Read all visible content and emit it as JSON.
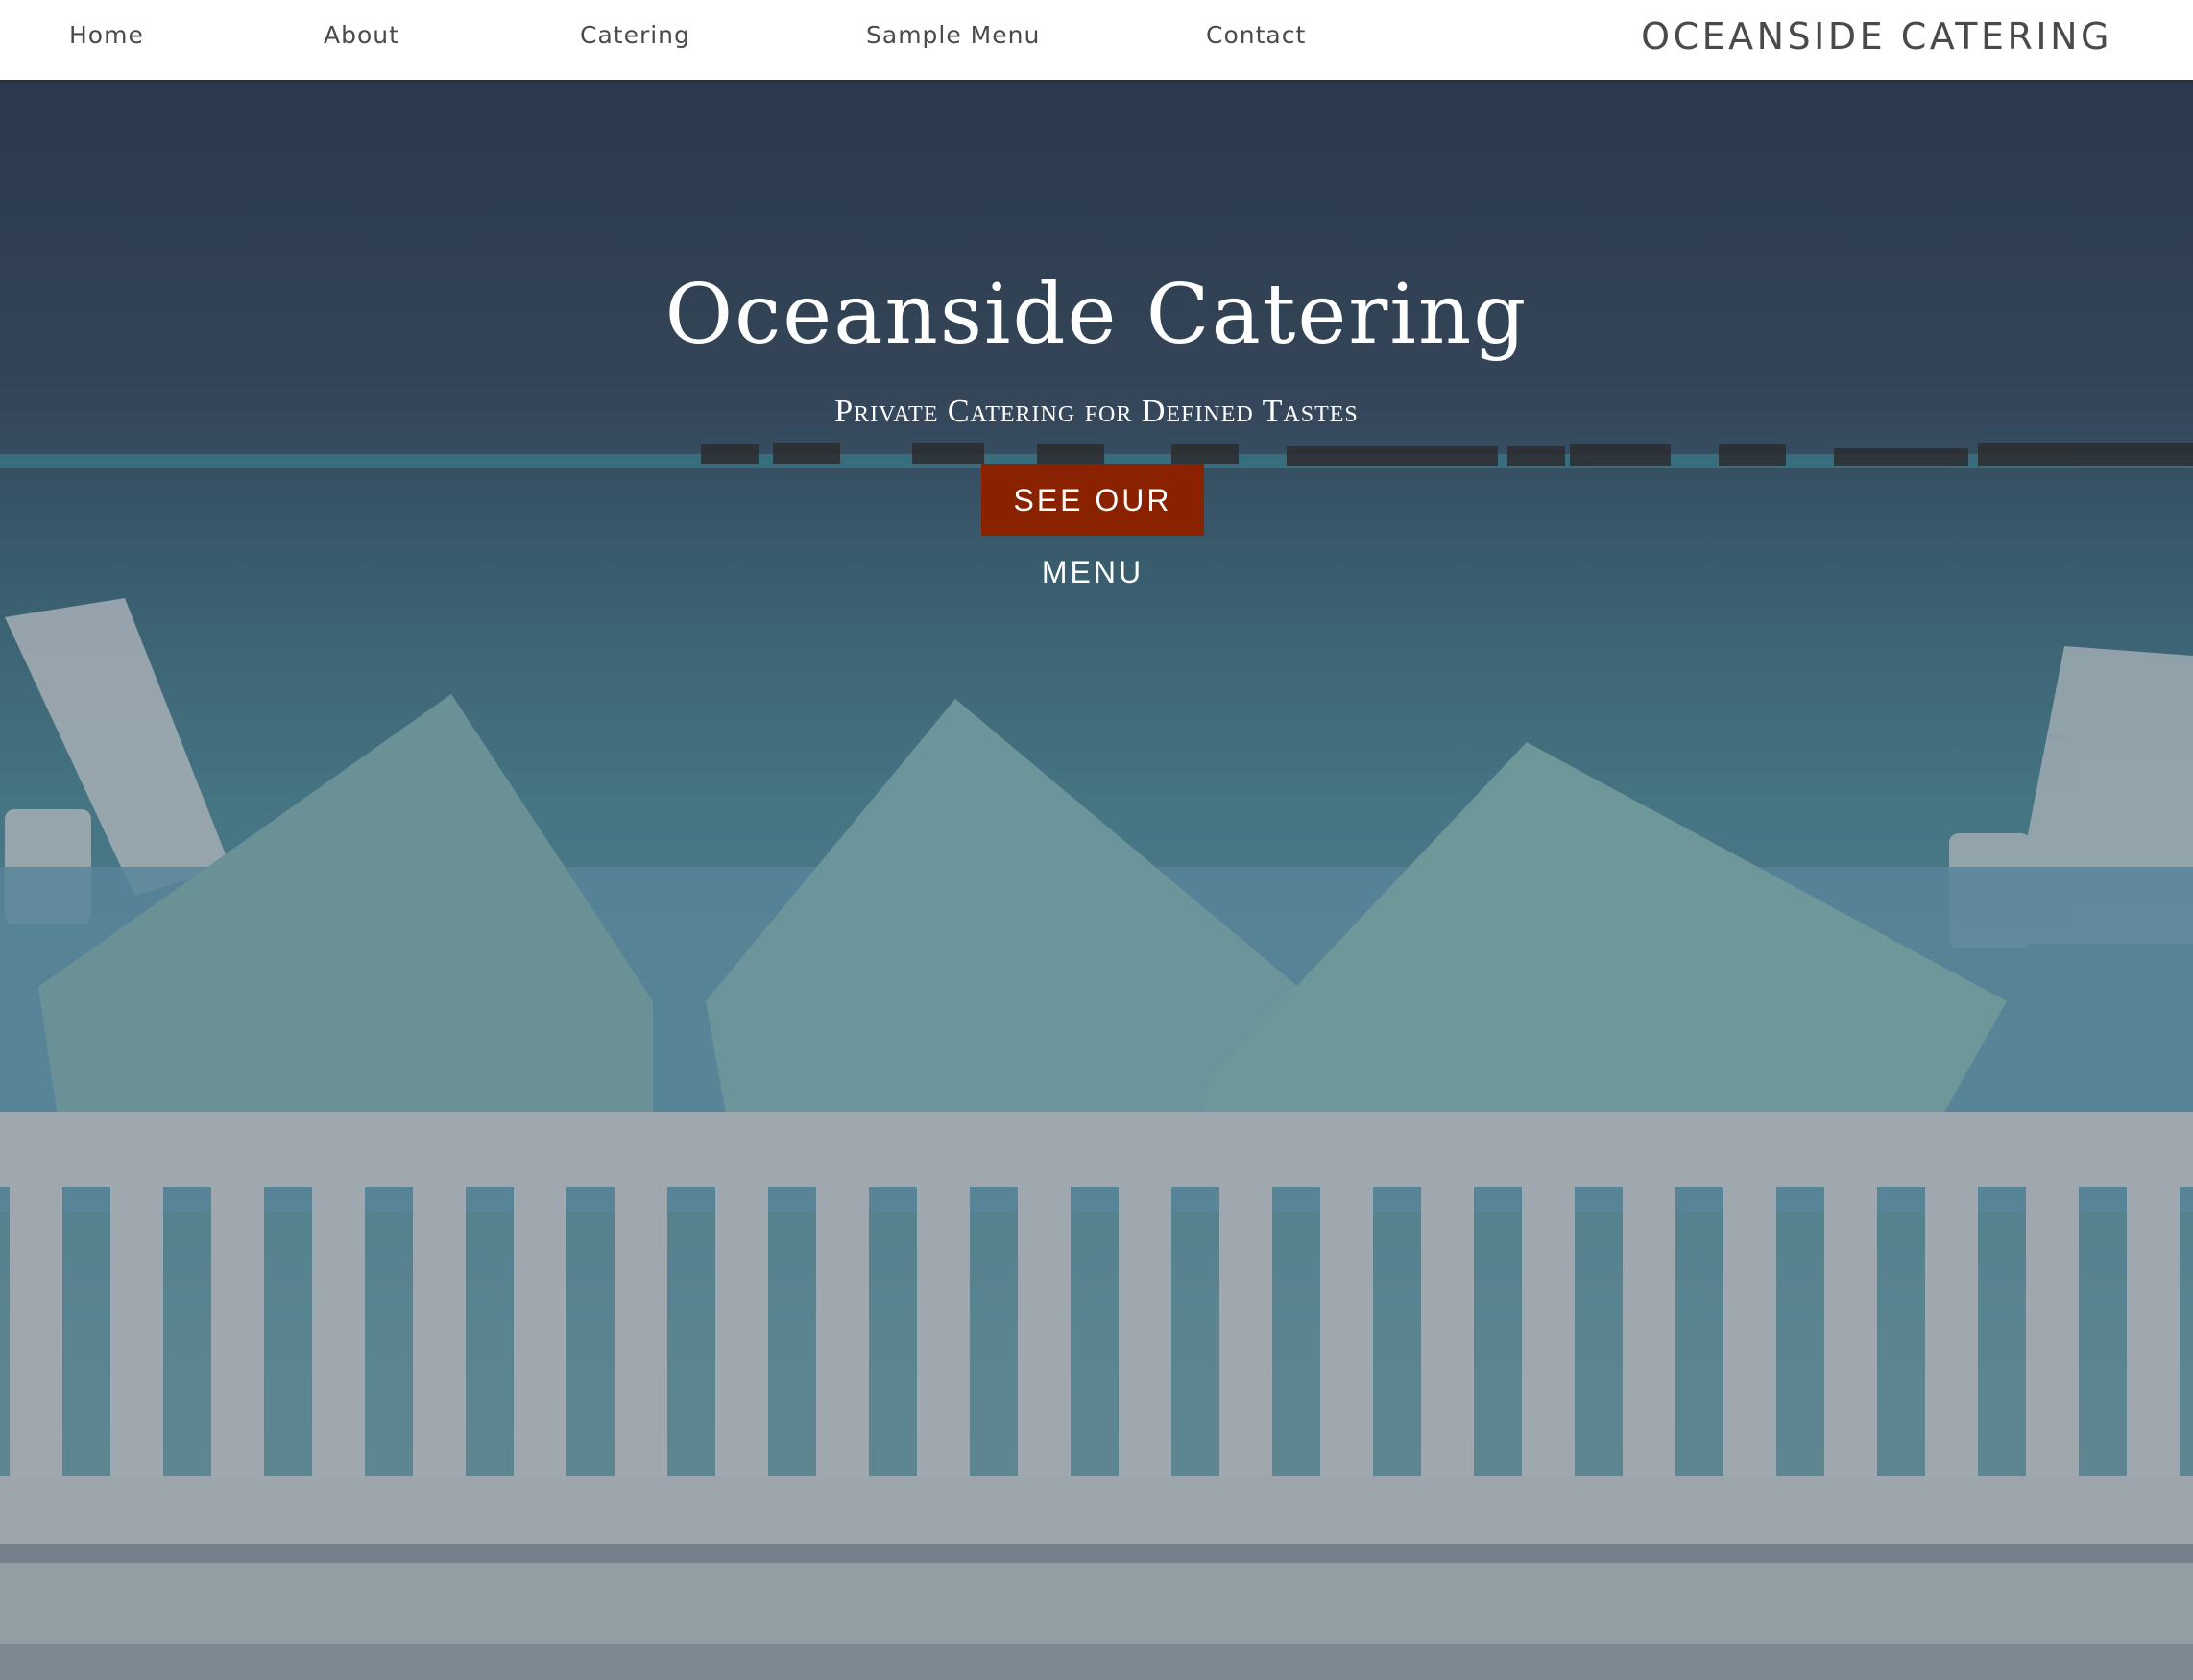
{
  "nav": {
    "items": [
      {
        "label": "Home"
      },
      {
        "label": "About"
      },
      {
        "label": "Catering"
      },
      {
        "label": "Sample Menu"
      },
      {
        "label": "Contact"
      }
    ],
    "brand": "OCEANSIDE CATERING"
  },
  "hero": {
    "title": "Oceanside Catering",
    "subtitle": "Private Catering for Defined Tastes",
    "cta_label": "SEE OUR MENU",
    "cta_color": "#8a2200",
    "image_icon": "beach-daybed-photo"
  }
}
